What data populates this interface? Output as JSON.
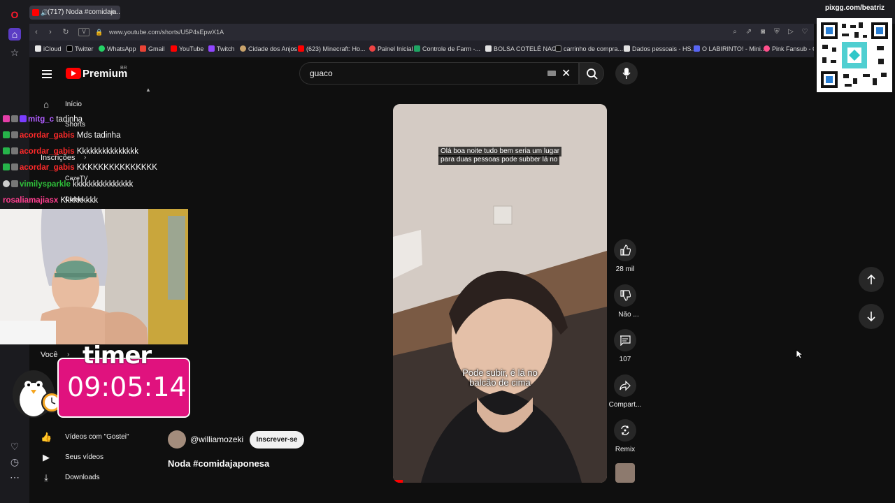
{
  "browser": {
    "tab_title": "(717) Noda #comidaja...",
    "url": "www.youtube.com/shorts/U5P4sEpwX1A",
    "bookmarks": [
      "iCloud",
      "Twitter",
      "WhatsApp",
      "Gmail",
      "YouTube",
      "Twitch",
      "Cidade dos Anjos",
      "(623) Minecraft: Ho...",
      "Painel Inicial",
      "Controle de Farm -...",
      "BOLSA COTELÉ NAG...",
      "carrinho de compra...",
      "Dados pessoais - HS...",
      "O LABIRINTO! - Mini...",
      "Pink Fansub - C"
    ]
  },
  "overlay": {
    "pixgg": "pixgg.com/beatriz",
    "timer_word": "timer",
    "timer_value": "09:05:14"
  },
  "youtube": {
    "brand": "Premium",
    "region": "BR",
    "search_value": "guaco",
    "sidebar": {
      "home": "Início",
      "shorts": "Shorts",
      "subscriptions": "Inscrições",
      "channel1": "CazeTV",
      "channel2": "Cortes...",
      "you": "Você",
      "liked": "Vídeos com \"Gostei\"",
      "your_videos": "Seus vídeos",
      "downloads": "Downloads"
    },
    "short": {
      "channel": "@williamozeki",
      "subscribe": "Inscrever-se",
      "title": "Noda #comidajaponesa",
      "caption_top_1": "Olá boa noite tudo bem seria um lugar",
      "caption_top_2": "para duas pessoas pode subber lá no",
      "caption_bottom_1": "Pode subir, é lá no",
      "caption_bottom_2": "balcão de cima"
    },
    "actions": {
      "likes": "28 mil",
      "dislike": "Não ...",
      "comments": "107",
      "share": "Compart...",
      "remix": "Remix"
    }
  },
  "chat": [
    {
      "user": "mitg_c",
      "msg": "tadinha",
      "color": "#b05cff"
    },
    {
      "user": "acordar_gabis",
      "msg": "Mds tadinha",
      "color": "#ff2a2a"
    },
    {
      "user": "acordar_gabis",
      "msg": "Kkkkkkkkkkkkkkk",
      "color": "#ff2a2a"
    },
    {
      "user": "acordar_gabis",
      "msg": "KKKKKKKKKKKKKKK",
      "color": "#ff2a2a"
    },
    {
      "user": "vimilysparkle",
      "msg": "kkkkkkkkkkkkkkk",
      "color": "#2fbf3a"
    },
    {
      "user": "rosaliamajiasx",
      "msg": "Kkkkkkkkk",
      "color": "#ff3e8f"
    }
  ]
}
